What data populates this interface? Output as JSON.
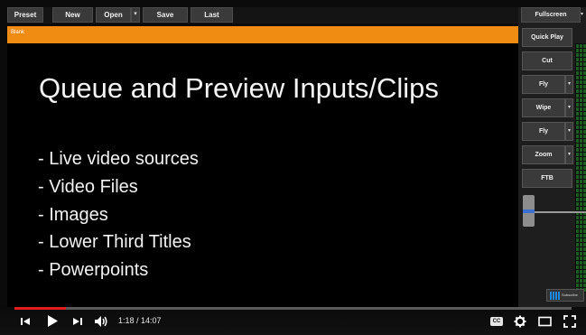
{
  "toolbar": {
    "preset_label": "Preset",
    "new_label": "New",
    "open_label": "Open",
    "open_arrow": "▾",
    "save_label": "Save",
    "last_label": "Last",
    "fullscreen_label": "Fullscreen",
    "fullscreen_arrow": "▾"
  },
  "input_bar": {
    "label": "Blank"
  },
  "slide": {
    "title": "Queue and Preview Inputs/Clips",
    "bullets": [
      "- Live video sources",
      "- Video Files",
      "- Images",
      "- Lower Third Titles",
      "- Powerpoints"
    ]
  },
  "transitions": {
    "quick_play": "Quick Play",
    "cut": "Cut",
    "fly1": "Fly",
    "wipe": "Wipe",
    "fly2": "Fly",
    "zoom": "Zoom",
    "ftb": "FTB",
    "arrow": "▾"
  },
  "subscribe": {
    "label": "Subscribe"
  },
  "player": {
    "time_current": "1:18",
    "time_total": "14:07",
    "time_display": "1:18 / 14:07",
    "progress": 0.092,
    "cc_label": "CC",
    "icons": [
      "skip-previous-icon",
      "play-icon",
      "skip-next-icon",
      "volume-icon",
      "captions-icon",
      "settings-icon",
      "theater-mode-icon",
      "fullscreen-icon"
    ]
  },
  "colors": {
    "accent_orange": "#f08c12",
    "progress_red": "#e21d1d",
    "meter_green": "#1b5e20",
    "tbar_blue": "#3b6fd0"
  }
}
